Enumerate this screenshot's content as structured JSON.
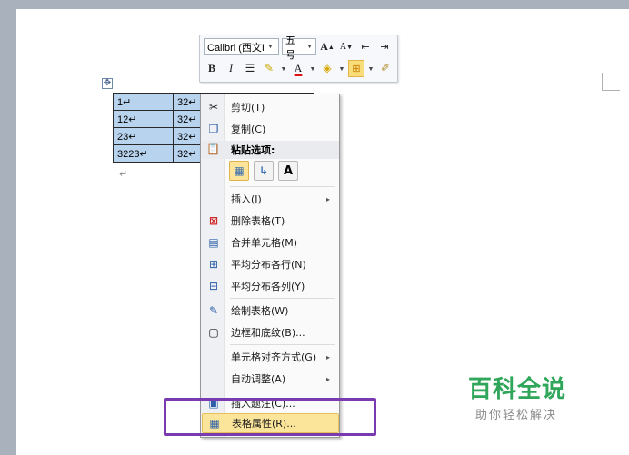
{
  "mini_toolbar": {
    "font_name": "Calibri (西文I",
    "font_size": "五号",
    "grow_font_icon": "A",
    "shrink_font_icon": "A",
    "bold": "B",
    "italic": "I",
    "font_color": "A"
  },
  "table": {
    "rows": [
      [
        "1↵",
        "32↵",
        "",
        ""
      ],
      [
        "12↵",
        "32↵",
        "",
        ""
      ],
      [
        "23↵",
        "32↵",
        "",
        ""
      ],
      [
        "3223↵",
        "32↵",
        "",
        ""
      ]
    ]
  },
  "paragraph_mark": "↵",
  "context_menu": {
    "cut": "剪切(T)",
    "copy": "复制(C)",
    "paste_heading": "粘贴选项:",
    "paste_text_icon": "A",
    "insert": "插入(I)",
    "delete_table": "删除表格(T)",
    "merge_cells": "合并单元格(M)",
    "distribute_rows": "平均分布各行(N)",
    "distribute_cols": "平均分布各列(Y)",
    "draw_table": "绘制表格(W)",
    "borders_shading": "边框和底纹(B)...",
    "cell_alignment": "单元格对齐方式(G)",
    "autofit": "自动调整(A)",
    "insert_caption": "插入题注(C)...",
    "table_properties": "表格属性(R)...",
    "submenu_arrow": "▸"
  },
  "watermark": {
    "title": "百科全说",
    "subtitle": "助你轻松解决"
  },
  "colors": {
    "table_selection": "#b8d3ee",
    "menu_highlight": "#fbe59a",
    "frame": "#7a3bb0",
    "watermark_green": "#2fa65a"
  }
}
